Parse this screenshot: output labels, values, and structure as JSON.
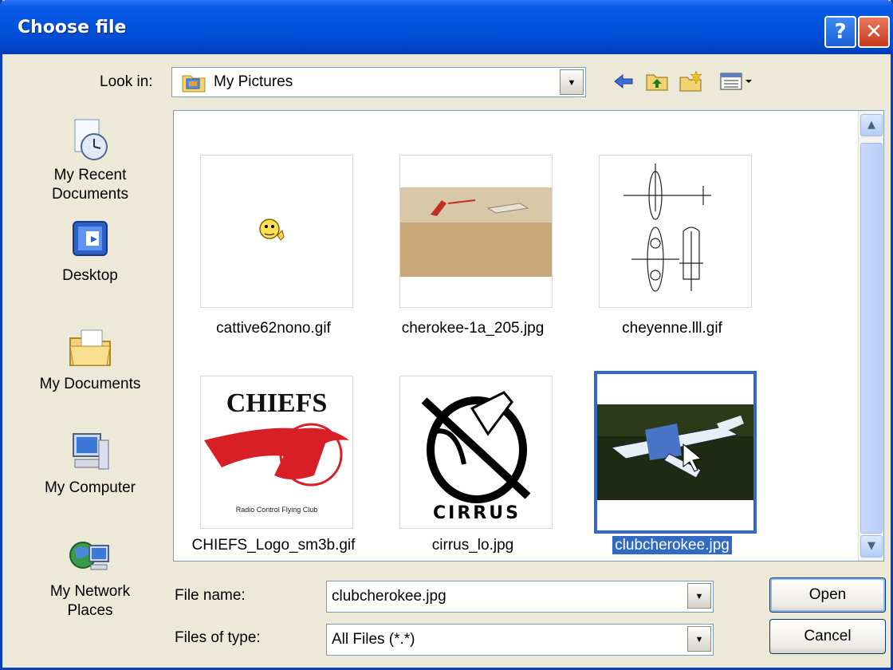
{
  "window": {
    "title": "Choose file",
    "help_label": "?",
    "close_label": "✕"
  },
  "toolbar": {
    "look_in_label": "Look in:",
    "look_in_value": "My Pictures",
    "icons": [
      "back-icon",
      "up-folder-icon",
      "new-folder-icon",
      "views-menu-icon"
    ]
  },
  "places": [
    {
      "label": "My Recent Documents",
      "icon": "recent-documents-icon"
    },
    {
      "label": "Desktop",
      "icon": "desktop-icon"
    },
    {
      "label": "My Documents",
      "icon": "my-documents-icon"
    },
    {
      "label": "My Computer",
      "icon": "my-computer-icon"
    },
    {
      "label": "My Network Places",
      "icon": "network-places-icon"
    }
  ],
  "files": [
    {
      "name": "cattive62nono.gif",
      "selected": false
    },
    {
      "name": "cherokee-1a_205.jpg",
      "selected": false
    },
    {
      "name": "cheyenne.lll.gif",
      "selected": false
    },
    {
      "name": "CHIEFS_Logo_sm3b.gif",
      "selected": false
    },
    {
      "name": "cirrus_lo.jpg",
      "selected": false
    },
    {
      "name": "clubcherokee.jpg",
      "selected": true
    }
  ],
  "thumbnails": {
    "chiefs_title": "CHIEFS",
    "chiefs_subtitle": "Radio Control Flying Club",
    "cirrus_text": "CIRRUS"
  },
  "form": {
    "file_name_label": "File name:",
    "file_name_value": "clubcherokee.jpg",
    "file_type_label": "Files of type:",
    "file_type_value": "All Files (*.*)"
  },
  "buttons": {
    "open": "Open",
    "cancel": "Cancel"
  },
  "colors": {
    "titlebar": "#0052dc",
    "selection": "#316ac5",
    "dialog_bg": "#ece9d8"
  }
}
